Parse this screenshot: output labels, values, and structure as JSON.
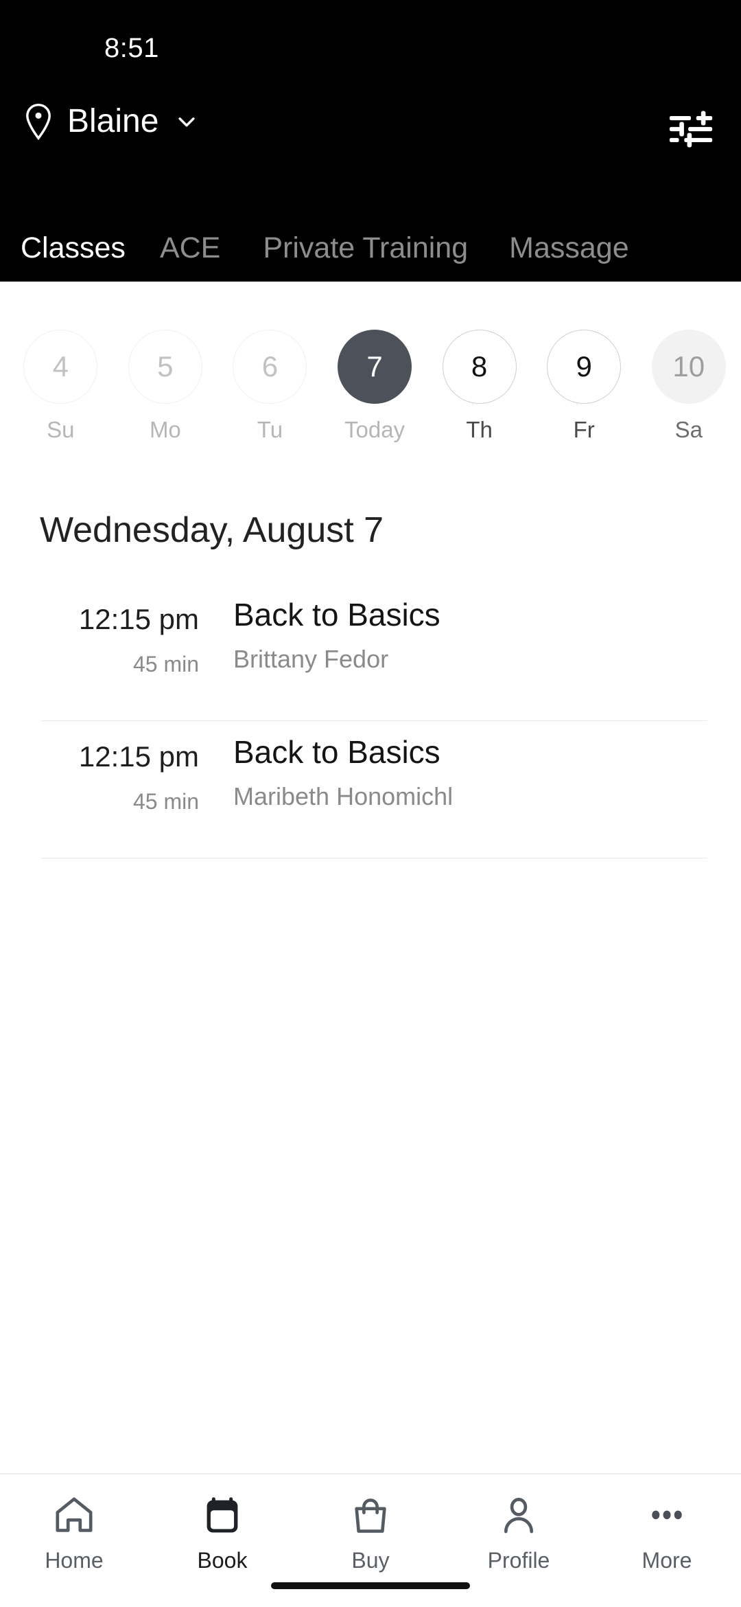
{
  "status_bar": {
    "time": "8:51"
  },
  "header": {
    "location_icon": "map-pin-icon",
    "location": "Blaine",
    "chevron_icon": "chevron-down-icon",
    "filter_icon": "filter-tune-icon"
  },
  "tabs": [
    {
      "label": "Classes",
      "active": true
    },
    {
      "label": "ACE",
      "active": false
    },
    {
      "label": "Private Training",
      "active": false
    },
    {
      "label": "Massage",
      "active": false
    }
  ],
  "date_strip": [
    {
      "day": "4",
      "label": "Su",
      "state": "past"
    },
    {
      "day": "5",
      "label": "Mo",
      "state": "past"
    },
    {
      "day": "6",
      "label": "Tu",
      "state": "past"
    },
    {
      "day": "7",
      "label": "Today",
      "state": "selected"
    },
    {
      "day": "8",
      "label": "Th",
      "state": "future"
    },
    {
      "day": "9",
      "label": "Fr",
      "state": "future"
    },
    {
      "day": "10",
      "label": "Sa",
      "state": "muted"
    }
  ],
  "schedule": {
    "date_title": "Wednesday, August 7",
    "classes": [
      {
        "time": "12:15 pm",
        "duration": "45 min",
        "name": "Back to Basics",
        "instructor": "Brittany Fedor"
      },
      {
        "time": "12:15 pm",
        "duration": "45 min",
        "name": "Back to Basics",
        "instructor": "Maribeth Honomichl"
      }
    ]
  },
  "bottom_nav": [
    {
      "label": "Home",
      "icon": "home-icon",
      "active": false
    },
    {
      "label": "Book",
      "icon": "calendar-icon",
      "active": true
    },
    {
      "label": "Buy",
      "icon": "shopping-bag-icon",
      "active": false
    },
    {
      "label": "Profile",
      "icon": "person-icon",
      "active": false
    },
    {
      "label": "More",
      "icon": "more-dots-icon",
      "active": false
    }
  ],
  "colors": {
    "header_bg": "#000000",
    "selected_day": "#4d525a",
    "muted_day": "#f2f2f2",
    "active_tab_text": "#ffffff",
    "inactive_tab_text": "#8d8d8d",
    "secondary_text": "#8a8a8a"
  }
}
